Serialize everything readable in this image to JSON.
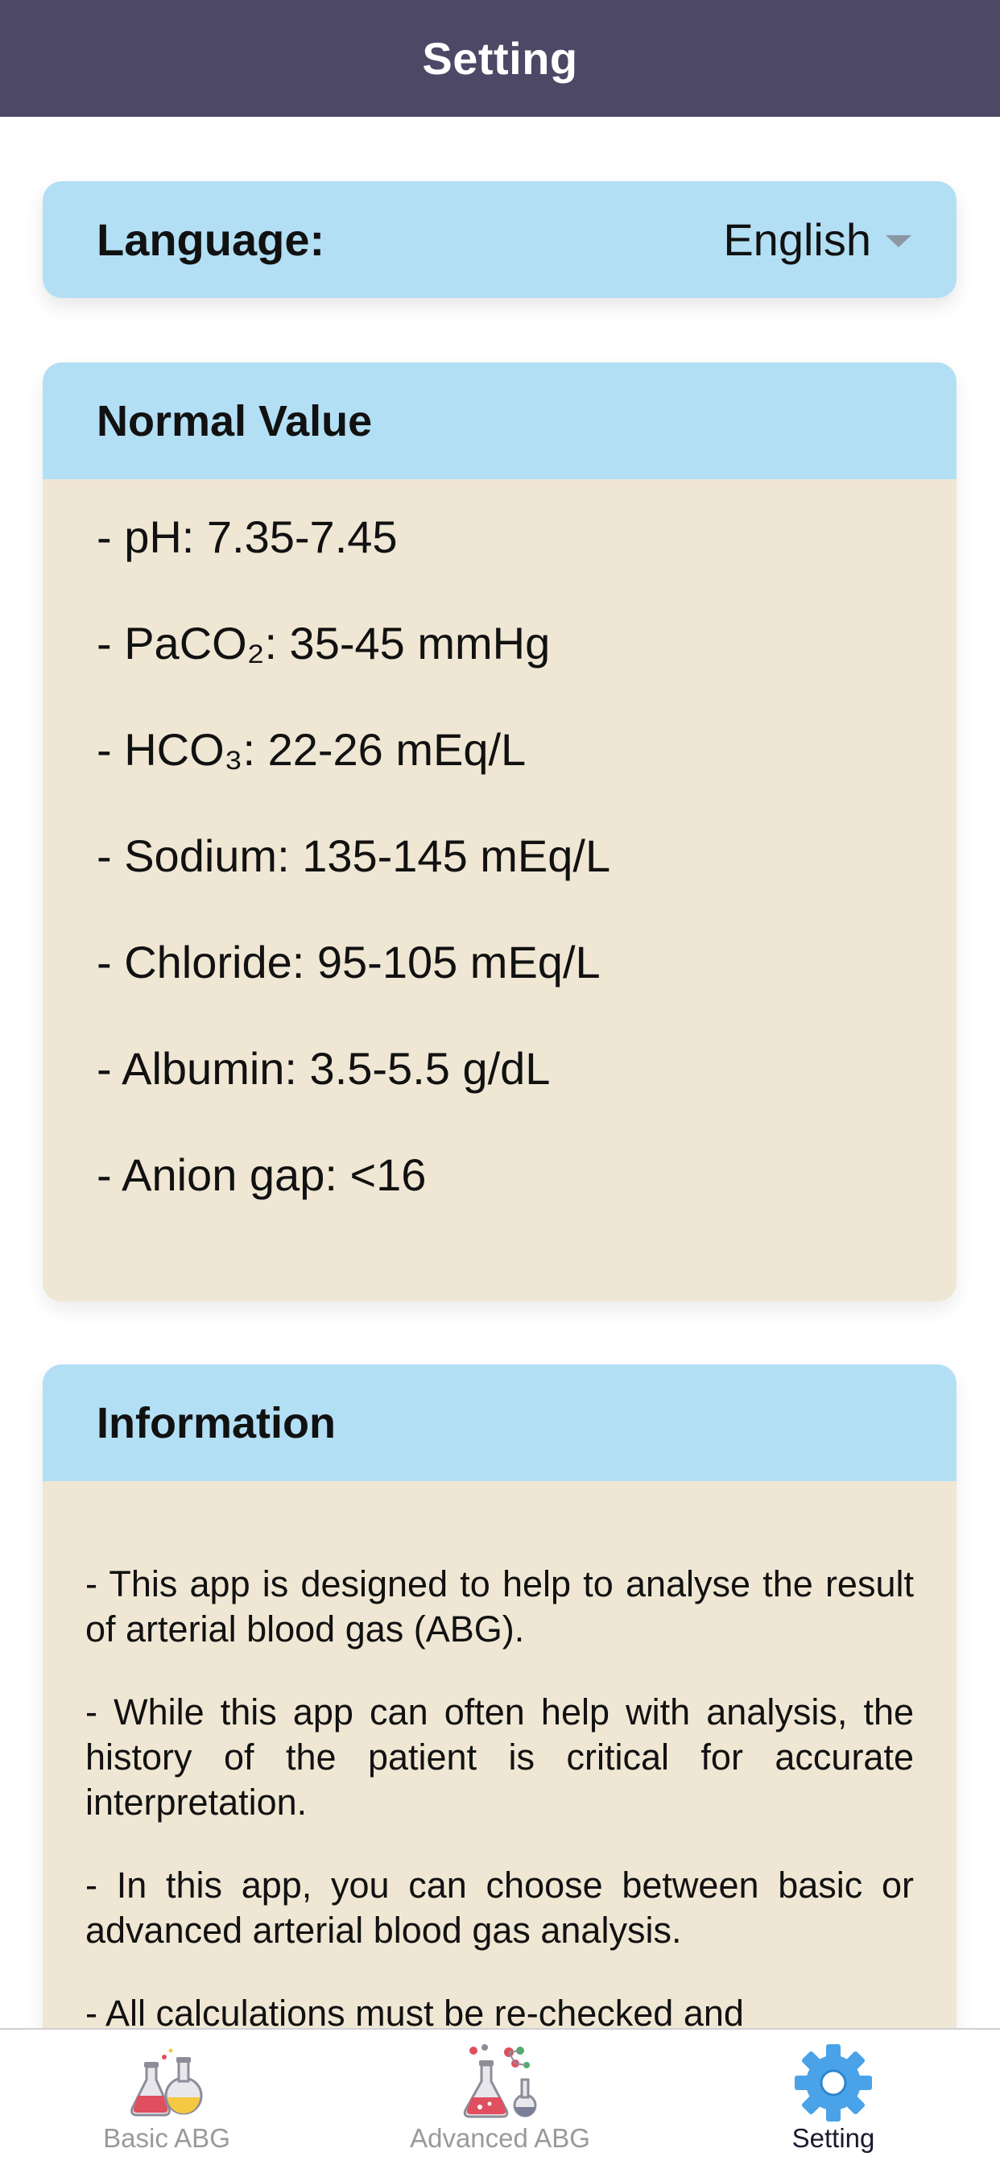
{
  "header": {
    "title": "Setting"
  },
  "language": {
    "label": "Language:",
    "selected": "English",
    "caret_icon": "caret-down-icon"
  },
  "normal_value": {
    "title": "Normal Value",
    "items": [
      "- pH: 7.35-7.45",
      "- PaCO₂: 35-45 mmHg",
      "- HCO₃: 22-26 mEq/L",
      "- Sodium: 135-145 mEq/L",
      "- Chloride: 95-105 mEq/L",
      "- Albumin: 3.5-5.5 g/dL",
      "- Anion gap: <16"
    ]
  },
  "information": {
    "title": "Information",
    "paragraphs": [
      "- This app is designed to help to analyse the result of arterial blood gas (ABG).",
      "- While this app can often help with analysis, the history of the patient is critical for accurate interpretation.",
      "- In this app, you can choose between basic or advanced arterial blood gas analysis.",
      "- All calculations must be re-checked and"
    ]
  },
  "tabbar": {
    "tabs": [
      {
        "label": "Basic ABG",
        "icon": "flasks-icon",
        "active": false
      },
      {
        "label": "Advanced ABG",
        "icon": "lab-flask-icon",
        "active": false
      },
      {
        "label": "Setting",
        "icon": "gear-icon",
        "active": true
      }
    ]
  },
  "colors": {
    "header_bg": "#4d4866",
    "card_head_bg": "#b3dff5",
    "card_body_bg": "#efe7d4",
    "active_tab_icon": "#4aa3e8",
    "inactive_tab_label": "#9a9a9a"
  }
}
